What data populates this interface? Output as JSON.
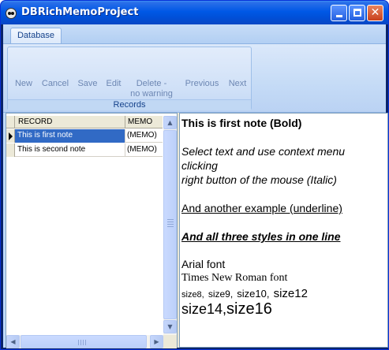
{
  "window": {
    "title": "DBRichMemoProject",
    "minimize_label": "",
    "maximize_label": "",
    "close_label": "✕"
  },
  "ribbon": {
    "tabs": [
      {
        "label": "Database",
        "active": true
      }
    ],
    "group_caption": "Records",
    "buttons": [
      {
        "label": "New",
        "enabled": false
      },
      {
        "label": "Cancel",
        "enabled": false
      },
      {
        "label": "Save",
        "enabled": false
      },
      {
        "label": "Edit",
        "enabled": false
      },
      {
        "label": "Delete -",
        "label_line2": "no warning",
        "enabled": false
      },
      {
        "label": "Previous",
        "enabled": false
      },
      {
        "label": "Next",
        "enabled": false
      }
    ]
  },
  "grid": {
    "columns": [
      "RECORD",
      "MEMO"
    ],
    "rows": [
      {
        "record": "This is first note",
        "memo": "(MEMO)",
        "selected": true
      },
      {
        "record": "This is second note",
        "memo": "(MEMO)",
        "selected": false
      }
    ],
    "scroll_up": "▲",
    "scroll_down": "▼",
    "scroll_left": "◀",
    "scroll_right": "▶"
  },
  "memo": {
    "line1": "This is first note (Bold)",
    "line2": "Select text and use context menu",
    "line3": "clicking",
    "line4": "right button of the mouse (Italic)",
    "line5": "And another example (underline)",
    "line6": "And all three styles in one line",
    "line7": "Arial font",
    "line8": "Times New Roman font",
    "sizes": {
      "s8": "size8,",
      "s9": "size9,",
      "s10": "size10,",
      "s12": "size12",
      "s14": "size14,",
      "s16": "size16"
    }
  },
  "colors": {
    "titlebar": "#0058e6",
    "selection": "#316ac5",
    "ribbon_text_disabled": "#6d87b3",
    "ribbon_caption": "#15428b"
  }
}
